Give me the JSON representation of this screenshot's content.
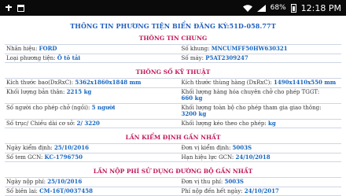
{
  "status": {
    "battery_pct": "68%",
    "time": "12:18 PM"
  },
  "title": "THÔNG TIN PHƯƠNG TIỆN BIỂN ĐĂNG KÝ:51D-058.77T",
  "general": {
    "heading": "THÔNG TIN CHUNG",
    "brand_label": "Nhãn hiệu:",
    "brand": "FORD",
    "chassis_label": "Số khung:",
    "chassis": "MNCUMFF50HW630321",
    "type_label": "Loại phương tiện:",
    "type": "Ô tô tải",
    "engine_label": "Số máy:",
    "engine": "P5AT2309247"
  },
  "specs": {
    "heading": "THÔNG SỐ KỸ THUẬT",
    "size_label": "Kích thước bao(DxRxC):",
    "size": "5362x1860x1848 mm",
    "cargo_size_label": "Kích thước thùng hàng (DxRxC):",
    "cargo_size": "1490x1410x550 mm",
    "curb_label": "Khối lượng bản thân:",
    "curb": "2215 kg",
    "payload_label": "Khối lượng hàng hóa chuyên chở cho phép TGGT:",
    "payload": "660 kg",
    "seats_label": "Số người cho phép chở (ngồi):",
    "seats": "5 người",
    "gross_label": "Khối lượng toàn bộ cho phép tham gia giao thông:",
    "gross": "3200 kg",
    "axle_label": "Số trục/ Chiều dài cơ sở:",
    "axle": "2/ 3220",
    "tow_label": "Khối lượng kéo theo cho phép:",
    "tow": "kg"
  },
  "inspection": {
    "heading": "LẦN KIỂM ĐỊNH GẦN NHẤT",
    "date_label": "Ngày kiểm định:",
    "date": "25/10/2016",
    "unit_label": "Đơn vị kiểm định:",
    "unit": "5003S",
    "cert_label": "Số tem GCN:",
    "cert": "KC-1796750",
    "expiry_label": "Hạn hiệu lực GCN:",
    "expiry": "24/10/2018"
  },
  "fee": {
    "heading": "LẦN NỘP PHÍ SỬ DỤNG ĐƯỜNG BỘ GẦN NHẤT",
    "date_label": "Ngày nộp phí:",
    "date": "25/10/2016",
    "unit_label": "Đơn vị thu phí:",
    "unit": "5003S",
    "receipt_label": "Số biên lai:",
    "receipt": "CM-16T/0037458",
    "expiry_label": "Phí nộp đến hết ngày:",
    "expiry": "24/10/2017"
  }
}
